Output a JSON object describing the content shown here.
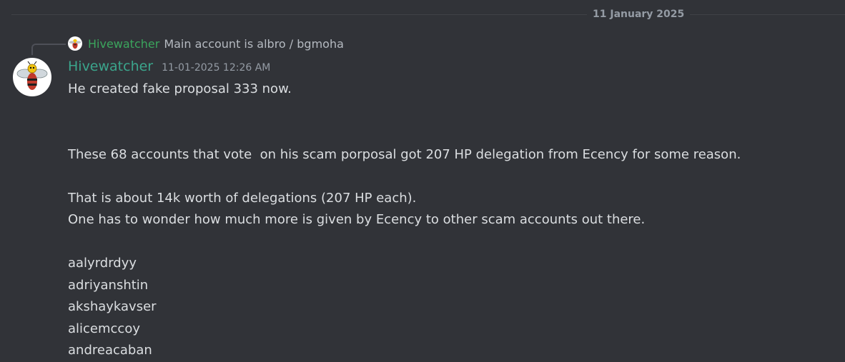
{
  "date_divider": "11 January 2025",
  "reply": {
    "author": "Hivewatcher",
    "text": "Main account is albro / bgmoha",
    "avatar_icon": "hornet-mascot-icon"
  },
  "message": {
    "author": "Hivewatcher",
    "author_color": "#3ba58c",
    "timestamp": "11-01-2025 12:26 AM",
    "avatar_icon": "hornet-mascot-icon",
    "lines": [
      "He created fake proposal 333 now.",
      "",
      "",
      "These 68 accounts that vote  on his scam porposal got 207 HP delegation from Ecency for some reason.",
      "",
      "That is about 14k worth of delegations (207 HP each).",
      "One has to wonder how much more is given by Ecency to other scam accounts out there.",
      "",
      "aalyrdrdyy",
      "adriyanshtin",
      "akshaykavser",
      "alicemccoy",
      "andreacaban"
    ]
  }
}
